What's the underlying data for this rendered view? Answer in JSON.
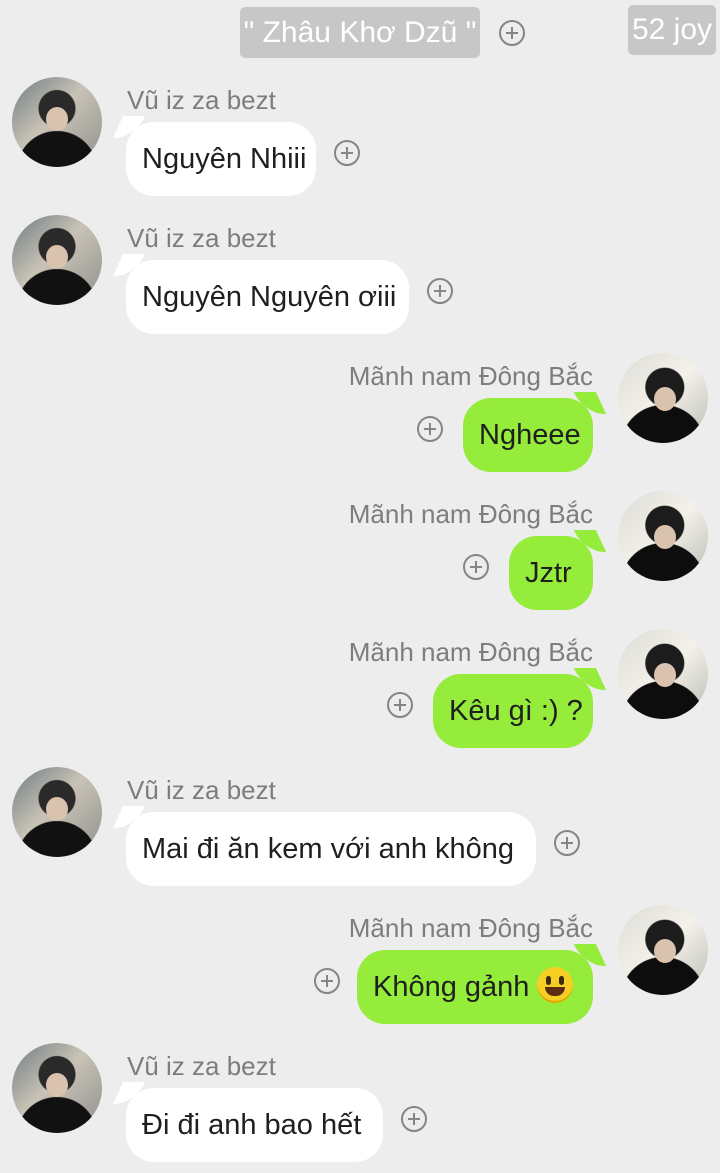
{
  "header": {
    "group_name": "\" Zhâu Khơ Dzũ \"",
    "counter": "52 joy"
  },
  "messages": [
    {
      "sender": "Vũ iz za bezt",
      "text": "Nguyên Nhiii",
      "side": "left"
    },
    {
      "sender": "Vũ iz za bezt",
      "text": "Nguyên Nguyên ơiii",
      "side": "left"
    },
    {
      "sender": "Mãnh nam Đông Bắc",
      "text": "Ngheee",
      "side": "right"
    },
    {
      "sender": "Mãnh nam Đông Bắc",
      "text": "Jztr",
      "side": "right"
    },
    {
      "sender": "Mãnh nam Đông Bắc",
      "text": "Kêu gì :) ?",
      "side": "right"
    },
    {
      "sender": "Vũ iz za bezt",
      "text": "Mai đi ăn kem với anh không",
      "side": "left"
    },
    {
      "sender": "Mãnh nam Đông Bắc",
      "text": "Không gảnh",
      "side": "right",
      "emoji": "smiling-face-icon"
    },
    {
      "sender": "Vũ iz za bezt",
      "text": "Đi đi anh bao hết",
      "side": "left"
    }
  ],
  "colors": {
    "background": "#ededed",
    "incoming_bubble": "#ffffff",
    "outgoing_bubble": "#95ec3a",
    "chip": "#c7c7c7"
  }
}
